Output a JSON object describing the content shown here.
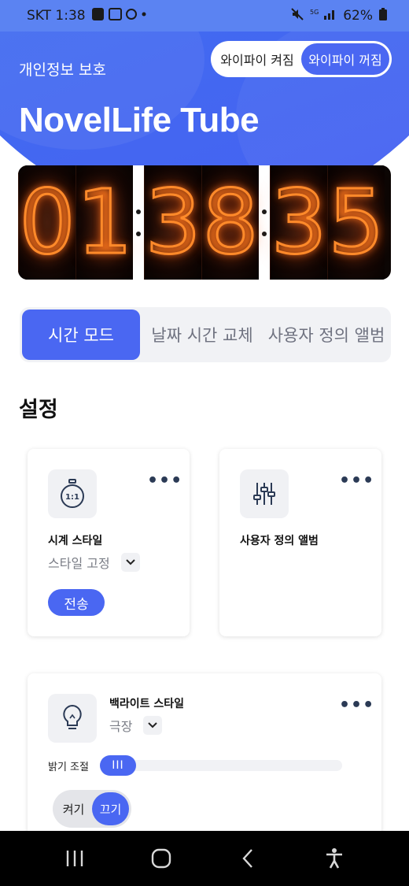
{
  "status_bar": {
    "carrier_time": "SKT 1:38",
    "battery": "62%"
  },
  "header": {
    "privacy_label": "개인정보 보호",
    "wifi_on": "와이파이 켜짐",
    "wifi_off": "와이파이 꺼짐",
    "title": "NovelLife Tube"
  },
  "clock": {
    "digits": [
      "0",
      "1",
      "3",
      "8",
      "3",
      "5"
    ]
  },
  "tabs": [
    {
      "label": "시간 모드"
    },
    {
      "label": "날짜 시간 교체"
    },
    {
      "label": "사용자 정의 앨범"
    }
  ],
  "settings": {
    "section_title": "설정",
    "more": "•••",
    "clock_style": {
      "title": "시계 스타일",
      "value": "스타일 고정",
      "send": "전송",
      "icon_text": "1:1"
    },
    "custom_album": {
      "title": "사용자 정의 앨범"
    },
    "backlight": {
      "title": "백라이트 스타일",
      "value": "극장",
      "brightness_label": "밝기 조절",
      "slider_glyph": "III",
      "brightness_level": 0.0,
      "on": "켜기",
      "off": "끄기"
    }
  },
  "colors": {
    "accent": "#4a67f2",
    "header_blue": "#3f6ff0",
    "tube_glow": "#ff8a2a"
  }
}
